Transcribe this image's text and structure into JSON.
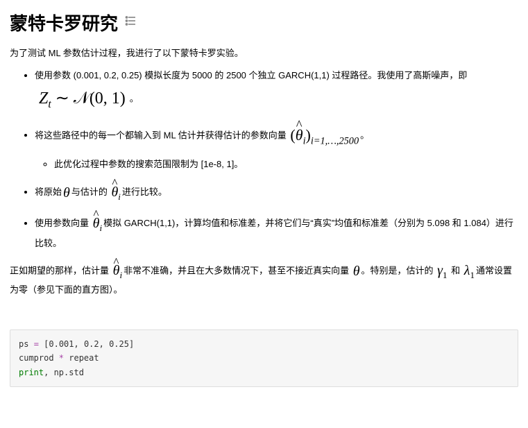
{
  "title": "蒙特卡罗研究",
  "icon_desc": "anchor-link-icon",
  "intro": "为了测试 ML 参数估计过程，我进行了以下蒙特卡罗实验。",
  "bullets": {
    "b1_pre": "使用参数 (0.001, 0.2, 0.25) 模拟长度为 5000 的 2500 个独立 GARCH(1,1) 过程路径。我使用了高斯噪声，即 ",
    "b1_math": "Z_t ∼ 𝒩(0,1)",
    "b1_post": "。",
    "b2_pre": "将这些路径中的每一个都输入到 ML 估计并获得估计的参数向量 ",
    "b2_math": "(θ̂_i)_{i=1,…,2500}",
    "b2_post": "。",
    "b2_sub": "此优化过程中参数的搜索范围限制为 [1e-8, 1]。",
    "b3_pre": "将原始",
    "b3_math1": "θ",
    "b3_mid": "与估计的 ",
    "b3_math2": "θ̂_i",
    "b3_post": "进行比较。",
    "b4_pre": "使用参数向量 ",
    "b4_math": "θ̂_i",
    "b4_post": "模拟 GARCH(1,1)，计算均值和标准差，并将它们与“真实”均值和标准差（分别为 5.098 和 1.084）进行比较。"
  },
  "followup": {
    "p1": "正如期望的那样，估计量 ",
    "m1": "θ̂_i",
    "p2": "非常不准确，并且在大多数情况下，甚至不接近真实向量 ",
    "m2": "θ",
    "p3": "。特别是，估计的 ",
    "m3": "γ_1",
    "p4": " 和 ",
    "m4": "λ_1",
    "p5": "通常设置为零（参见下面的直方图）。"
  },
  "code": {
    "line1_pre": "ps ",
    "line1_op": "=",
    "line1_post": " [0.001, 0.2, 0.25]",
    "blank": " ",
    "line2_a": "cumprod ",
    "line2_op": "*",
    "line2_b": " repeat",
    "line3_a": "print",
    "line3_b": ", np.std"
  }
}
